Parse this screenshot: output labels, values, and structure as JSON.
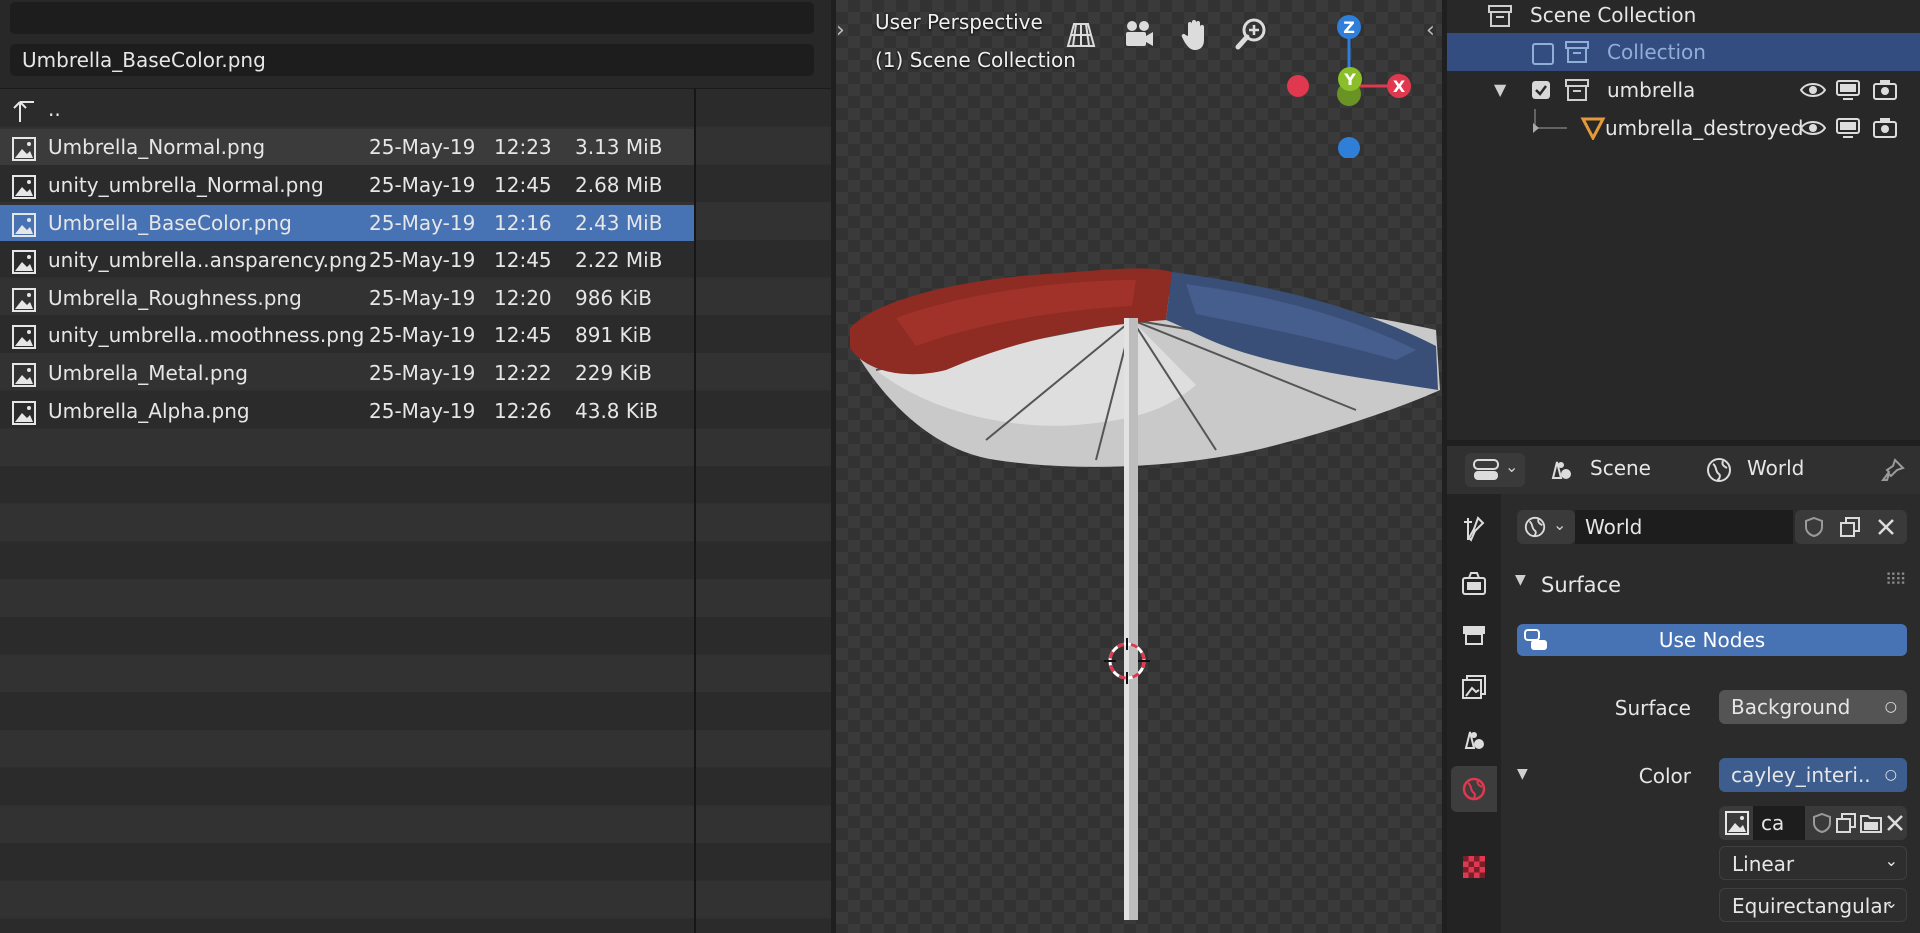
{
  "file_browser": {
    "filename_field": "Umbrella_BaseColor.png",
    "parent_label": "..",
    "files": [
      {
        "name": "Umbrella_Normal.png",
        "date": "25-May-19",
        "time": "12:23",
        "size": "3.13 MiB"
      },
      {
        "name": "unity_umbrella_Normal.png",
        "date": "25-May-19",
        "time": "12:45",
        "size": "2.68 MiB"
      },
      {
        "name": "Umbrella_BaseColor.png",
        "date": "25-May-19",
        "time": "12:16",
        "size": "2.43 MiB"
      },
      {
        "name": "unity_umbrella..ansparency.png",
        "date": "25-May-19",
        "time": "12:45",
        "size": "2.22 MiB"
      },
      {
        "name": "Umbrella_Roughness.png",
        "date": "25-May-19",
        "time": "12:20",
        "size": "986 KiB"
      },
      {
        "name": "unity_umbrella..moothness.png",
        "date": "25-May-19",
        "time": "12:45",
        "size": "891 KiB"
      },
      {
        "name": "Umbrella_Metal.png",
        "date": "25-May-19",
        "time": "12:22",
        "size": "229 KiB"
      },
      {
        "name": "Umbrella_Alpha.png",
        "date": "25-May-19",
        "time": "12:26",
        "size": "43.8 KiB"
      }
    ]
  },
  "viewport": {
    "view_name": "User Perspective",
    "collection_info": "(1) Scene Collection",
    "gizmo": {
      "z": "Z",
      "y": "Y",
      "x": "X"
    },
    "colors": {
      "x_axis": "#e0384f",
      "y_axis": "#8bbf2a",
      "z_axis": "#2f7fd9"
    }
  },
  "outliner": {
    "root": "Scene Collection",
    "items": [
      {
        "label": "Collection"
      },
      {
        "label": "umbrella"
      },
      {
        "label": "umbrella_destroyed"
      }
    ]
  },
  "properties": {
    "header": {
      "scene": "Scene",
      "world": "World"
    },
    "world_name": "World",
    "panel_title": "Surface",
    "use_nodes_label": "Use Nodes",
    "surface_label": "Surface",
    "surface_value": "Background",
    "color_label": "Color",
    "color_value": "cayley_interi..",
    "image_name": "ca",
    "interpolation": "Linear",
    "projection": "Equirectangular",
    "accent": "#4772b3"
  }
}
